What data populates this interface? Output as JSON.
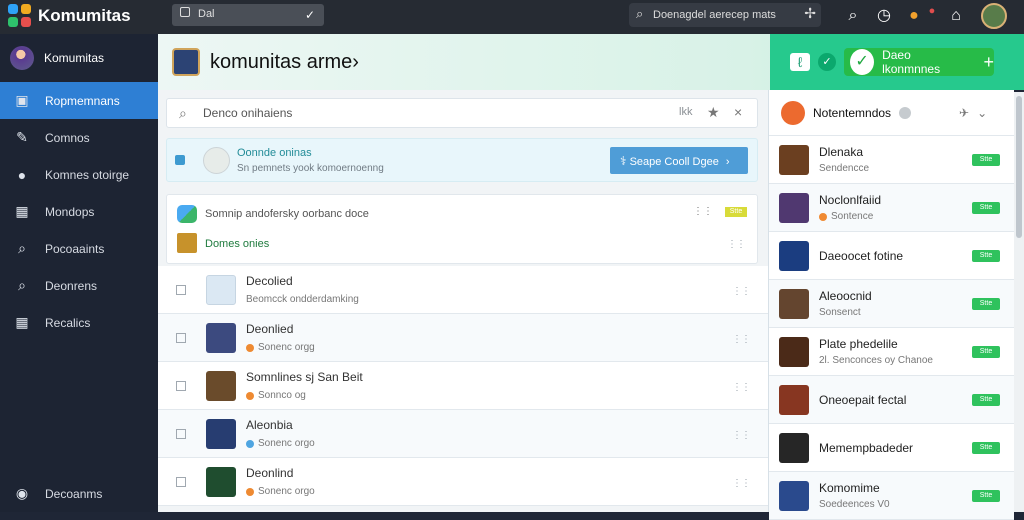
{
  "app": {
    "name": "Komumitas",
    "window_select": "Dal",
    "top_search": "Doenagdel aerecep mats",
    "colors": {
      "sidebar": "#1d2433",
      "active": "#2e7fd4",
      "header": "#bfe9d6",
      "green": "#27bb48"
    }
  },
  "sidebar": {
    "user": "Komumitas",
    "items": [
      {
        "label": "Ropmemnans",
        "icon": "user-card-icon",
        "active": true
      },
      {
        "label": "Comnos",
        "icon": "pencil-icon"
      },
      {
        "label": "Komnes otoirge",
        "icon": "person-icon"
      },
      {
        "label": "Mondops",
        "icon": "grid-icon"
      },
      {
        "label": "Pocoaaints",
        "icon": "magnifier-icon"
      },
      {
        "label": "Deonrens",
        "icon": "search-icon"
      },
      {
        "label": "Recalics",
        "icon": "table-icon"
      }
    ],
    "footer": "Decoanms"
  },
  "header": {
    "title": "komunitas arme›",
    "button_label": "Daeo lkonmnnes"
  },
  "search": {
    "placeholder": "Denco onihaiens",
    "right_text": "lkk"
  },
  "notice": {
    "title": "Oonnde oninas",
    "subtitle": "Sn pemnets yook komoernoenng",
    "button": "Seape Cooll Dgee"
  },
  "card": {
    "heading": "Somnip andofersky oorbanc doce",
    "badge": "Stte",
    "subheading": "Domes onies"
  },
  "list": [
    {
      "title": "Decolied",
      "subtitle": "Beomcck ondderdamking",
      "color": "#dbe8f3"
    },
    {
      "title": "Deonlied",
      "subtitle": "Sonenc orgg",
      "color": "#3c4a7f"
    },
    {
      "title": "Somnlines sj San Beit",
      "subtitle": "Sonnco og",
      "color": "#6a4b2b"
    },
    {
      "title": "Aleonbia",
      "subtitle": "Sonenc orgo",
      "color": "#273d71"
    },
    {
      "title": "Deonlind",
      "subtitle": "Sonenc orgo",
      "color": "#1f4d2f"
    }
  ],
  "right": {
    "heading": "Notentemndos",
    "items": [
      {
        "title": "Dlenaka",
        "sub": "Sendencce",
        "badge": "Stte",
        "color": "#6b3f20"
      },
      {
        "title": "Noclonlfaiid",
        "sub": "Sontence",
        "badge": "Stte",
        "color": "#503870"
      },
      {
        "title": "Daeoocet fotine",
        "sub": "",
        "badge": "Stte",
        "color": "#1b3d80"
      },
      {
        "title": "Aleoocnid",
        "sub": "Sonsenct",
        "badge": "Stte",
        "color": "#64452f"
      },
      {
        "title": "Plate phedelile",
        "sub": "2l. Senconces oy Chanoe",
        "badge": "Stte",
        "color": "#4b2a18"
      },
      {
        "title": "Oneoepait fectal",
        "sub": "",
        "badge": "Stte",
        "color": "#873621"
      },
      {
        "title": "Memempbadeder",
        "sub": "",
        "badge": "Stte",
        "color": "#262626"
      },
      {
        "title": "Komomime",
        "sub": "Soedeences V0",
        "badge": "Stte",
        "color": "#2a4a8d"
      }
    ]
  }
}
